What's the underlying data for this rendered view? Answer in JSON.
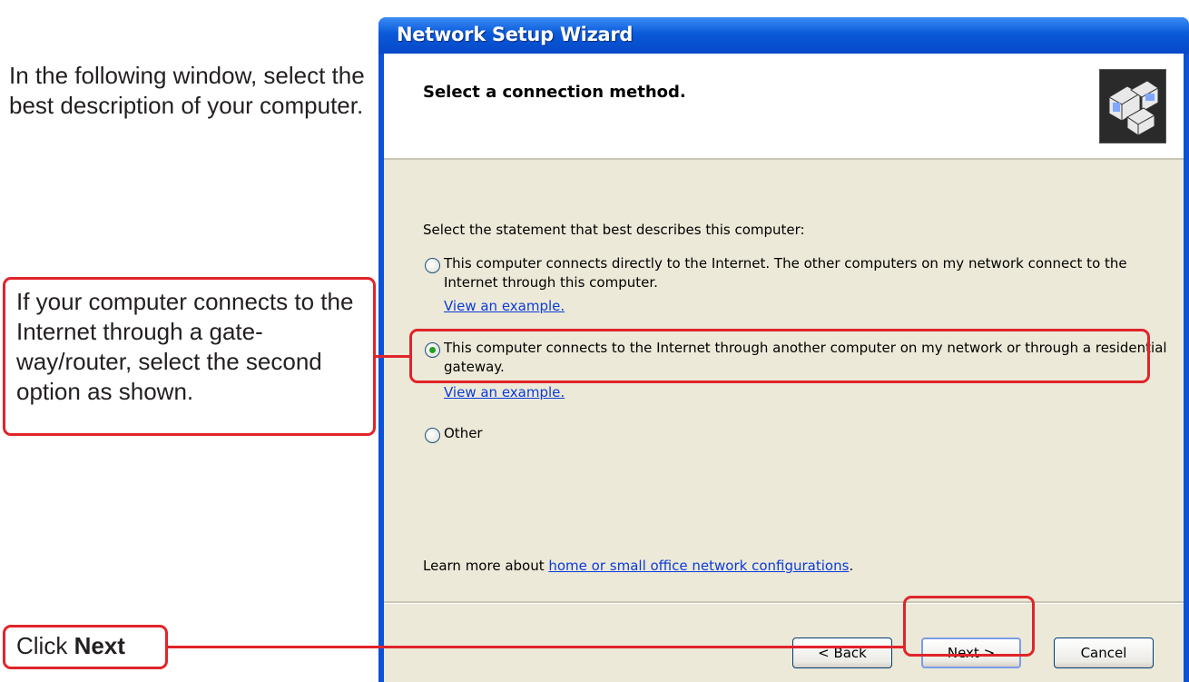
{
  "instructions": {
    "intro": "In the following window, select the best description of your computer.",
    "route_callout": "If your computer connects to the Internet through a gate-way/router, select the second option as shown.",
    "next_callout_prefix": "Click ",
    "next_callout_bold": "Next"
  },
  "window": {
    "title": "Network Setup Wizard",
    "header_title": "Select a connection method.",
    "header_icon": "network-computers-icon",
    "prompt": "Select the statement that best describes this computer:",
    "options": [
      {
        "label": "This computer connects directly to the Internet. The other computers on my network connect to the Internet through this computer.",
        "link": "View an example.",
        "selected": false
      },
      {
        "label": "This computer connects to the Internet through another computer on my network or through a residential gateway.",
        "link": "View an example.",
        "selected": true
      },
      {
        "label": "Other",
        "selected": false
      }
    ],
    "learn_more_prefix": "Learn more about ",
    "learn_more_link": "home or small office network configurations",
    "learn_more_suffix": ".",
    "buttons": {
      "back": "< Back",
      "next": "Next >",
      "cancel": "Cancel"
    }
  },
  "colors": {
    "callout_red": "#e0242a",
    "title_blue": "#0a52d6",
    "dialog_beige": "#ece9d8",
    "link_blue": "#0b3bd9",
    "radio_green": "#21a121"
  }
}
